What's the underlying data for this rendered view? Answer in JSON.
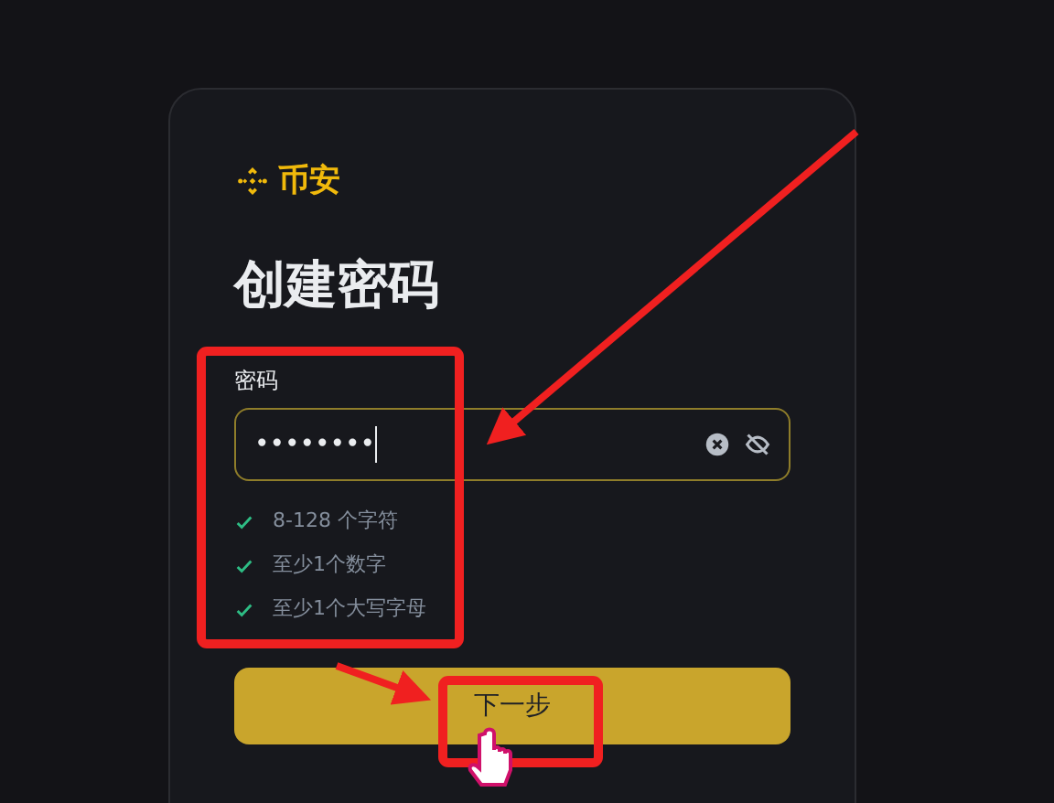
{
  "brand": {
    "name": "币安"
  },
  "heading": "创建密码",
  "password": {
    "label": "密码",
    "value": "••••••••",
    "focused": true
  },
  "requirements": [
    {
      "text": "8-128 个字符",
      "checked": true
    },
    {
      "text": "至少1个数字",
      "checked": true
    },
    {
      "text": "至少1个大写字母",
      "checked": true
    }
  ],
  "next_button": {
    "label": "下一步"
  }
}
